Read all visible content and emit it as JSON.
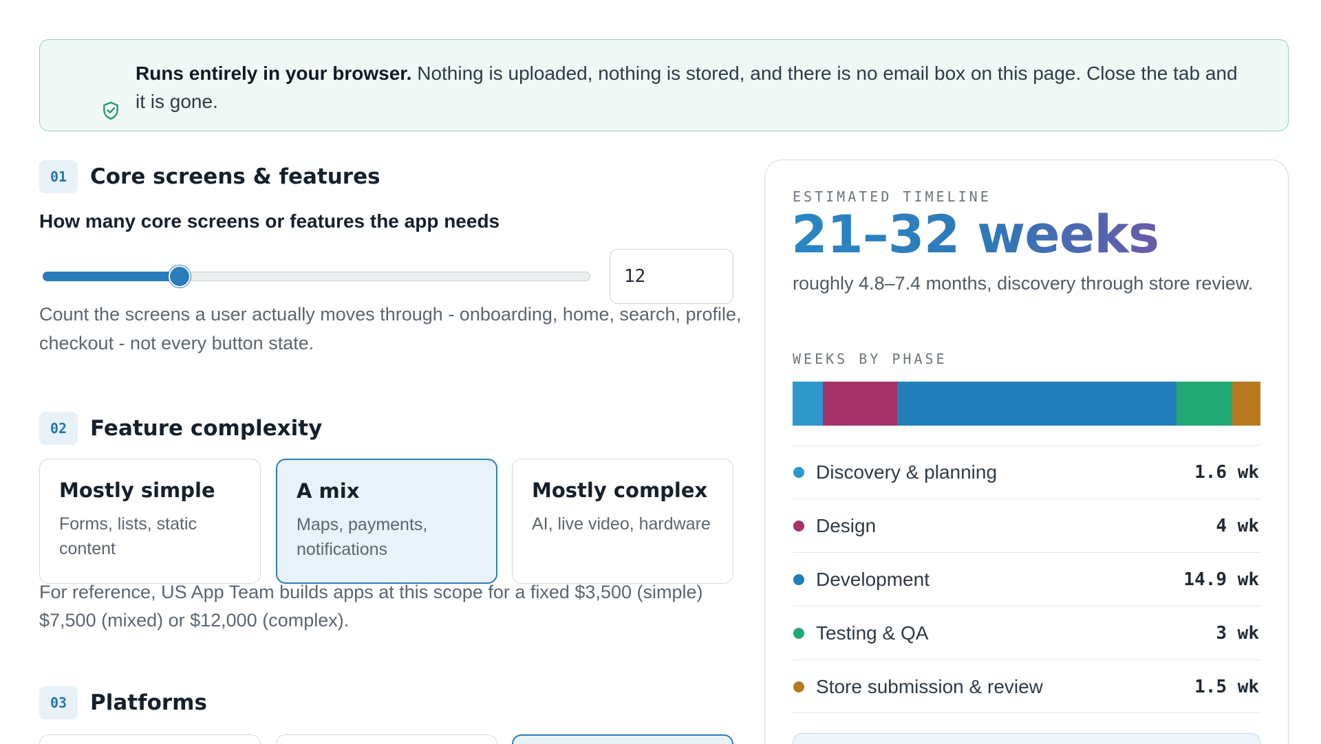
{
  "notice": {
    "bold": "Runs entirely in your browser.",
    "text": " Nothing is uploaded, nothing is stored, and there is no email box on this page. Close the tab and it is gone.",
    "icon": "shield-check-icon"
  },
  "sections": {
    "s1": {
      "num": "01",
      "title": "Core screens & features"
    },
    "s2": {
      "num": "02",
      "title": "Feature complexity"
    },
    "s3": {
      "num": "03",
      "title": "Platforms"
    }
  },
  "screens": {
    "question": "How many core screens or features the app needs",
    "value": "12",
    "slider_fraction": 0.25,
    "help": "Count the screens a user actually moves through - onboarding, home, search, profile, checkout - not every button state."
  },
  "complexity": {
    "options": [
      {
        "title": "Mostly simple",
        "desc": "Forms, lists, static content"
      },
      {
        "title": "A mix",
        "desc": "Maps, payments, notifications"
      },
      {
        "title": "Mostly complex",
        "desc": "AI, live video, hardware"
      }
    ],
    "selected": "A mix",
    "reference": "For reference, US App Team builds apps at this scope for a fixed $3,500 (simple) $7,500 (mixed) or $12,000 (complex)."
  },
  "result": {
    "eyebrow": "ESTIMATED TIMELINE",
    "headline": "21–32 weeks",
    "subline": "roughly 4.8–7.4 months, discovery through store review.",
    "phases_label": "WEEKS BY PHASE",
    "phases": [
      {
        "name": "Discovery & planning",
        "value": "1.6 wk",
        "weeks": 1.6,
        "color": "#2e97cc"
      },
      {
        "name": "Design",
        "value": "4 wk",
        "weeks": 4,
        "color": "#a8326a"
      },
      {
        "name": "Development",
        "value": "14.9 wk",
        "weeks": 14.9,
        "color": "#237fba"
      },
      {
        "name": "Testing & QA",
        "value": "3 wk",
        "weeks": 3,
        "color": "#22a873"
      },
      {
        "name": "Store submission & review",
        "value": "1.5 wk",
        "weeks": 1.5,
        "color": "#b8791f"
      }
    ]
  }
}
